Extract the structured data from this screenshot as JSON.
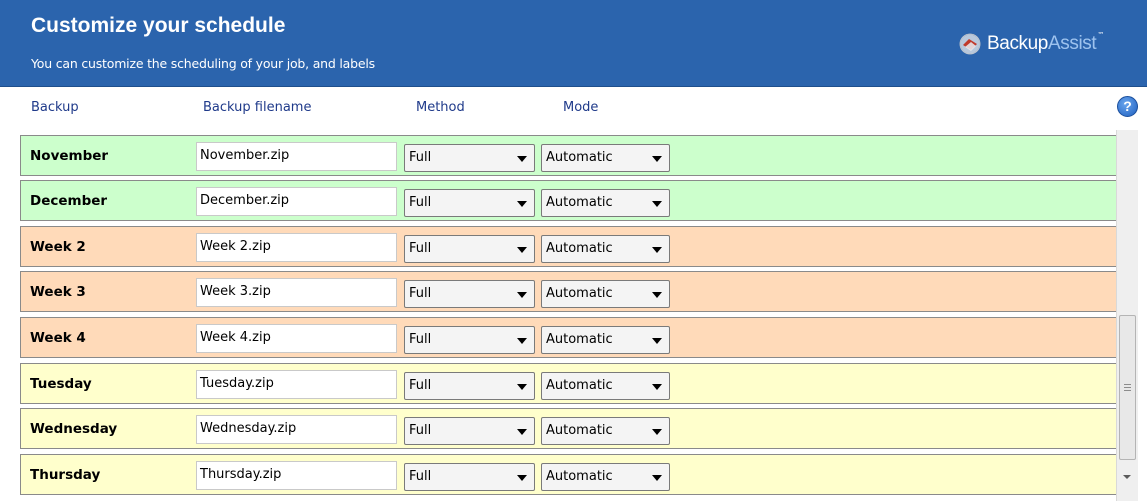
{
  "header": {
    "title": "Customize your schedule",
    "subtitle": "You can customize the scheduling of your job, and labels",
    "brand_primary": "Backup",
    "brand_secondary": "Assist",
    "brand_tm": "™"
  },
  "columns": {
    "backup": "Backup",
    "filename": "Backup filename",
    "method": "Method",
    "mode": "Mode"
  },
  "help_label": "?",
  "colors": {
    "header_bg": "#2b64ad",
    "green_row": "#ccffcc",
    "peach_row": "#ffdab9",
    "yellow_row": "#ffffcc",
    "column_header_text": "#1f3a8a"
  },
  "rows": [
    {
      "label": "November",
      "filename": "November.zip",
      "method": "Full",
      "mode": "Automatic",
      "color": "green"
    },
    {
      "label": "December",
      "filename": "December.zip",
      "method": "Full",
      "mode": "Automatic",
      "color": "green"
    },
    {
      "label": "Week 2",
      "filename": "Week 2.zip",
      "method": "Full",
      "mode": "Automatic",
      "color": "peach"
    },
    {
      "label": "Week 3",
      "filename": "Week 3.zip",
      "method": "Full",
      "mode": "Automatic",
      "color": "peach"
    },
    {
      "label": "Week 4",
      "filename": "Week 4.zip",
      "method": "Full",
      "mode": "Automatic",
      "color": "peach"
    },
    {
      "label": "Tuesday",
      "filename": "Tuesday.zip",
      "method": "Full",
      "mode": "Automatic",
      "color": "yellow"
    },
    {
      "label": "Wednesday",
      "filename": "Wednesday.zip",
      "method": "Full",
      "mode": "Automatic",
      "color": "yellow"
    },
    {
      "label": "Thursday",
      "filename": "Thursday.zip",
      "method": "Full",
      "mode": "Automatic",
      "color": "yellow"
    }
  ]
}
